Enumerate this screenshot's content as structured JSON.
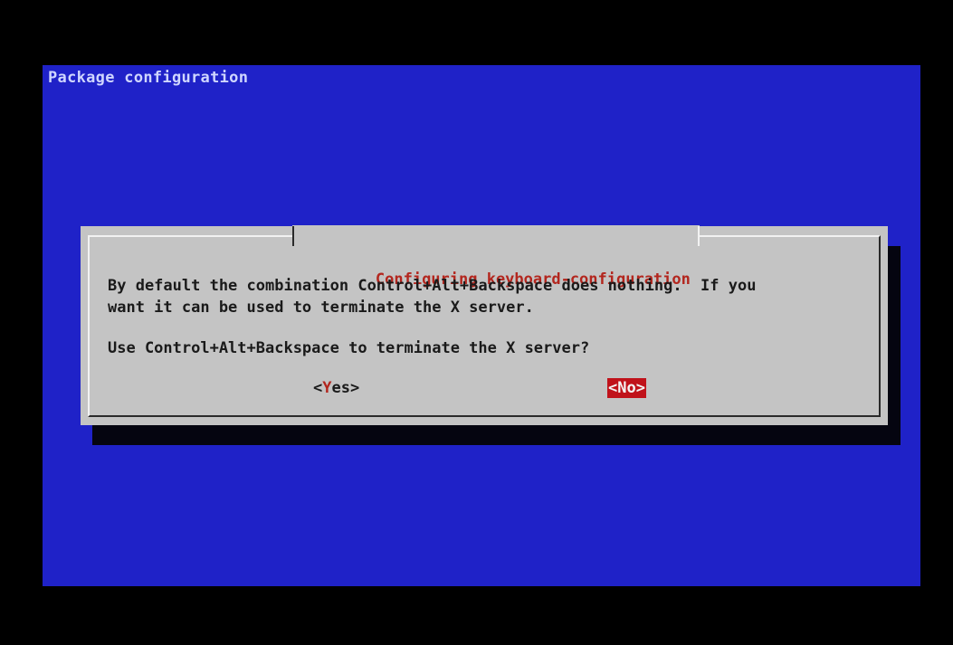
{
  "backtitle": "Package configuration",
  "dialog": {
    "title": "Configuring keyboard-configuration",
    "message_line1": "By default the combination Control+Alt+Backspace does nothing.  If you",
    "message_line2": "want it can be used to terminate the X server.",
    "question": "Use Control+Alt+Backspace to terminate the X server?"
  },
  "buttons": {
    "yes": {
      "open": "<",
      "hotkey": "Y",
      "rest": "es",
      "close": ">"
    },
    "no": {
      "label": "<No>",
      "selected": true
    }
  },
  "colors": {
    "screen_background": "#1f22c8",
    "dialog_background": "#c4c4c4",
    "title_text": "#b3261e",
    "selected_button": "#c0121a"
  }
}
